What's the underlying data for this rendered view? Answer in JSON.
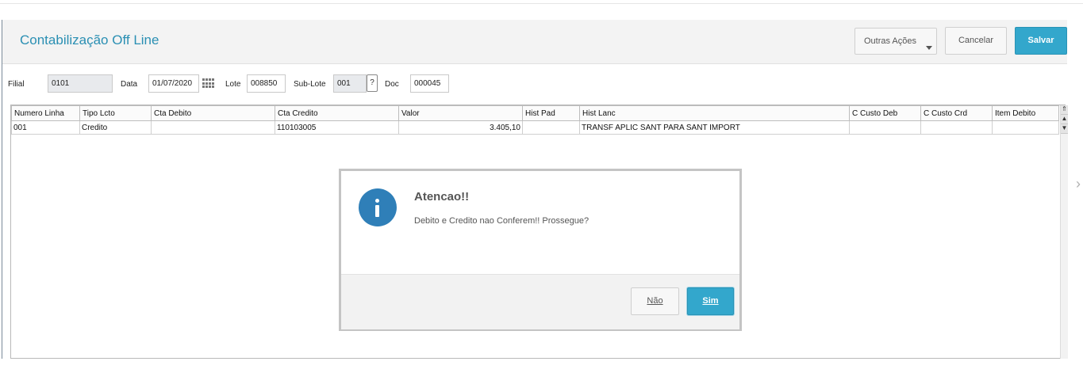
{
  "header": {
    "title": "Contabilização Off Line",
    "outras_acoes": "Outras Ações",
    "cancelar": "Cancelar",
    "salvar": "Salvar"
  },
  "form": {
    "filial_label": "Filial",
    "filial_value": "0101",
    "data_label": "Data",
    "data_value": "01/07/2020",
    "lote_label": "Lote",
    "lote_value": "008850",
    "sublote_label": "Sub-Lote",
    "sublote_value": "001",
    "sublote_help": "?",
    "doc_label": "Doc",
    "doc_value": "000045"
  },
  "grid": {
    "columns": [
      "Numero Linha",
      "Tipo Lcto",
      "Cta Debito",
      "Cta Credito",
      "Valor",
      "Hist Pad",
      "Hist Lanc",
      "C Custo Deb",
      "C Custo Crd",
      "Item Debito"
    ],
    "rows": [
      [
        "001",
        "Credito",
        "",
        "110103005",
        "3.405,10",
        "",
        "TRANSF APLIC SANT PARA SANT IMPORT",
        "",
        "",
        ""
      ]
    ]
  },
  "dialog": {
    "title": "Atencao!!",
    "message": "Debito e Credito nao Conferem!! Prossegue?",
    "no_label": "Não",
    "yes_label": "Sim",
    "icon": "info-icon"
  },
  "colors": {
    "accent": "#2a8fb3",
    "primary_button": "#33a7cc",
    "info_icon": "#2f7fb8"
  }
}
